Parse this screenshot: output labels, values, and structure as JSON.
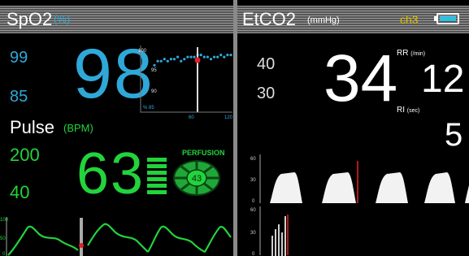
{
  "spo2": {
    "title": "SpO2",
    "unit": "(%)",
    "limit_high": "99",
    "limit_low": "85",
    "value": "98",
    "trend": {
      "y_ticks": [
        "100",
        "95",
        "90",
        "% 85"
      ],
      "x_ticks": [
        "60",
        "120"
      ],
      "points": [
        96,
        97,
        97,
        97.5,
        97,
        97.5,
        97.5,
        98,
        97,
        97.5,
        98,
        98,
        98,
        98.5,
        98.5,
        98,
        98,
        97.5,
        98,
        98,
        98.5,
        98,
        98.5,
        98.5
      ]
    }
  },
  "pulse": {
    "title": "Pulse",
    "unit": "(BPM)",
    "limit_high": "200",
    "limit_low": "40",
    "value": "63",
    "perfusion_label": "PERFUSION",
    "perfusion_value": "43",
    "pleth_y_ticks": [
      "100",
      "50",
      "0"
    ]
  },
  "etco2": {
    "title": "EtCO2",
    "unit": "(mmHg)",
    "channel": "ch3",
    "limit_high": "40",
    "limit_low": "30",
    "value": "34",
    "rr_label": "RR",
    "rr_unit": "(/min)",
    "rr_value": "12",
    "ri_label": "RI",
    "ri_unit": "(sec)",
    "ri_value": "5",
    "capno_y_ticks": [
      "60",
      "30",
      "0"
    ],
    "lower_y_ticks": [
      "60",
      "30",
      "0"
    ]
  },
  "colors": {
    "cyan": "#2fa8d8",
    "green": "#22d33c",
    "yellow": "#e0c000",
    "red": "#e0202a"
  }
}
